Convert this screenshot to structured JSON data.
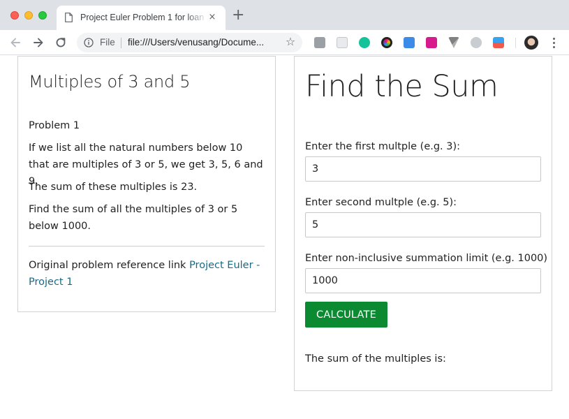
{
  "browser": {
    "tab_title": "Project Euler Problem 1 for loan",
    "tab_close": "×",
    "new_tab": "+",
    "omnibox": {
      "scheme_label": "File",
      "url": "file:///Users/venusang/Docume..."
    },
    "extensions": [
      "extension-icon",
      "extension-icon",
      "grammarly-icon",
      "extension-icon",
      "extension-icon",
      "extension-icon",
      "extension-icon",
      "extension-icon",
      "extension-icon"
    ],
    "accent_colors": {
      "tabbar": "#dee1e6",
      "omnibox": "#f1f3f4"
    }
  },
  "problem": {
    "title": "Multiples of 3 and 5",
    "number": "Problem 1",
    "paragraph1": "If we list all the natural numbers below 10 that are multiples of 3 or 5, we get 3, 5, 6 and 9.",
    "paragraph2": "The sum of these multiples is 23.",
    "paragraph3": "Find the sum of all the multiples of 3 or 5 below 1000.",
    "reference_prefix": "Original problem reference link",
    "reference_link_text": "Project Euler - Project 1"
  },
  "calculator": {
    "title": "Find the Sum",
    "first_label": "Enter the first multple (e.g. 3):",
    "first_value": "3",
    "second_label": "Enter second multple (e.g. 5):",
    "second_value": "5",
    "limit_label": "Enter non-inclusive summation limit (e.g. 1000)",
    "limit_value": "1000",
    "button_label": "CALCULATE",
    "result_label": "The sum of the multiples is:",
    "button_color": "#0b8a32",
    "link_color": "#1a6a86"
  }
}
